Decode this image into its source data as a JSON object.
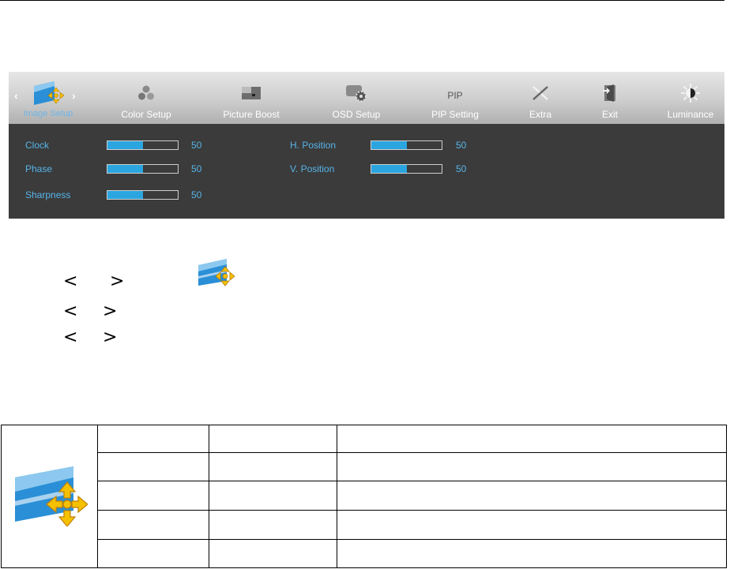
{
  "osd": {
    "tabs": [
      {
        "label": "Image Setup",
        "icon": "image-setup-icon",
        "active": true
      },
      {
        "label": "Color Setup",
        "icon": "color-setup-icon"
      },
      {
        "label": "Picture Boost",
        "icon": "picture-boost-icon"
      },
      {
        "label": "OSD Setup",
        "icon": "osd-setup-icon"
      },
      {
        "label": "PIP Setting",
        "icon": "pip-icon",
        "icon_text": "PIP"
      },
      {
        "label": "Extra",
        "icon": "extra-tools-icon"
      },
      {
        "label": "Exit",
        "icon": "exit-door-icon"
      },
      {
        "label": "Luminance",
        "icon": "luminance-sun-icon"
      }
    ],
    "settings_left": [
      {
        "label": "Clock",
        "value": "50",
        "level": 0.5
      },
      {
        "label": "Phase",
        "value": "50",
        "level": 0.5
      },
      {
        "label": "Sharpness",
        "value": "50",
        "level": 0.5
      }
    ],
    "settings_right": [
      {
        "label": "H. Position",
        "value": "50",
        "level": 0.5
      },
      {
        "label": "V. Position",
        "value": "50",
        "level": 0.5
      }
    ]
  },
  "instructions": {
    "arrows": [
      "<",
      ">"
    ],
    "inline_icon": "image-setup-icon"
  },
  "colors": {
    "panel_bg": "#3b3b3b",
    "label_blue": "#56b4e9",
    "slider_fill": "#2ba5df",
    "icon_blue": "#2a8fd6",
    "icon_arrow": "#f5c000"
  }
}
